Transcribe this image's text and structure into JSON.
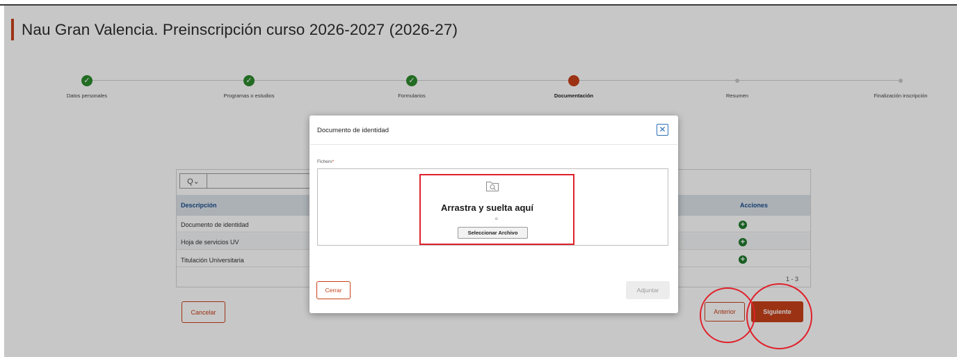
{
  "page": {
    "title": "Nau Gran Valencia. Preinscripción curso 2026-2027 (2026-27)"
  },
  "stepper": {
    "steps": [
      {
        "label": "Datos personales",
        "state": "done"
      },
      {
        "label": "Programas o estudios",
        "state": "done"
      },
      {
        "label": "Formularios",
        "state": "done"
      },
      {
        "label": "Documentación",
        "state": "current"
      },
      {
        "label": "Resumen",
        "state": "todo"
      },
      {
        "label": "Finalización inscripción",
        "state": "todo"
      }
    ],
    "check_glyph": "✓"
  },
  "documents": {
    "search_icon_glyph": "Q⌄",
    "columns": {
      "description": "Descripción",
      "actions": "Acciones"
    },
    "rows": [
      {
        "label": "Documento de identidad"
      },
      {
        "label": "Hoja de servicios UV"
      },
      {
        "label": "Titulación Universitaria"
      }
    ],
    "add_glyph": "+",
    "pager": "1 - 3",
    "cancel_label": "Cancelar",
    "previous_label": "Anterior",
    "next_label": "Siguiente"
  },
  "modal": {
    "title": "Documento de identidad",
    "close_glyph": "✕",
    "file_label": "Fichero",
    "required_mark": "*",
    "drop_text": "Arrastra y suelta aquí",
    "or_text": "o",
    "select_label": "Seleccionar Archivo",
    "close_label": "Cerrar",
    "attach_label": "Adjuntar"
  },
  "colors": {
    "accent": "#c8401a",
    "done": "#2e8b2e",
    "annotation": "#e0202a",
    "header_link": "#1a4d8c"
  }
}
